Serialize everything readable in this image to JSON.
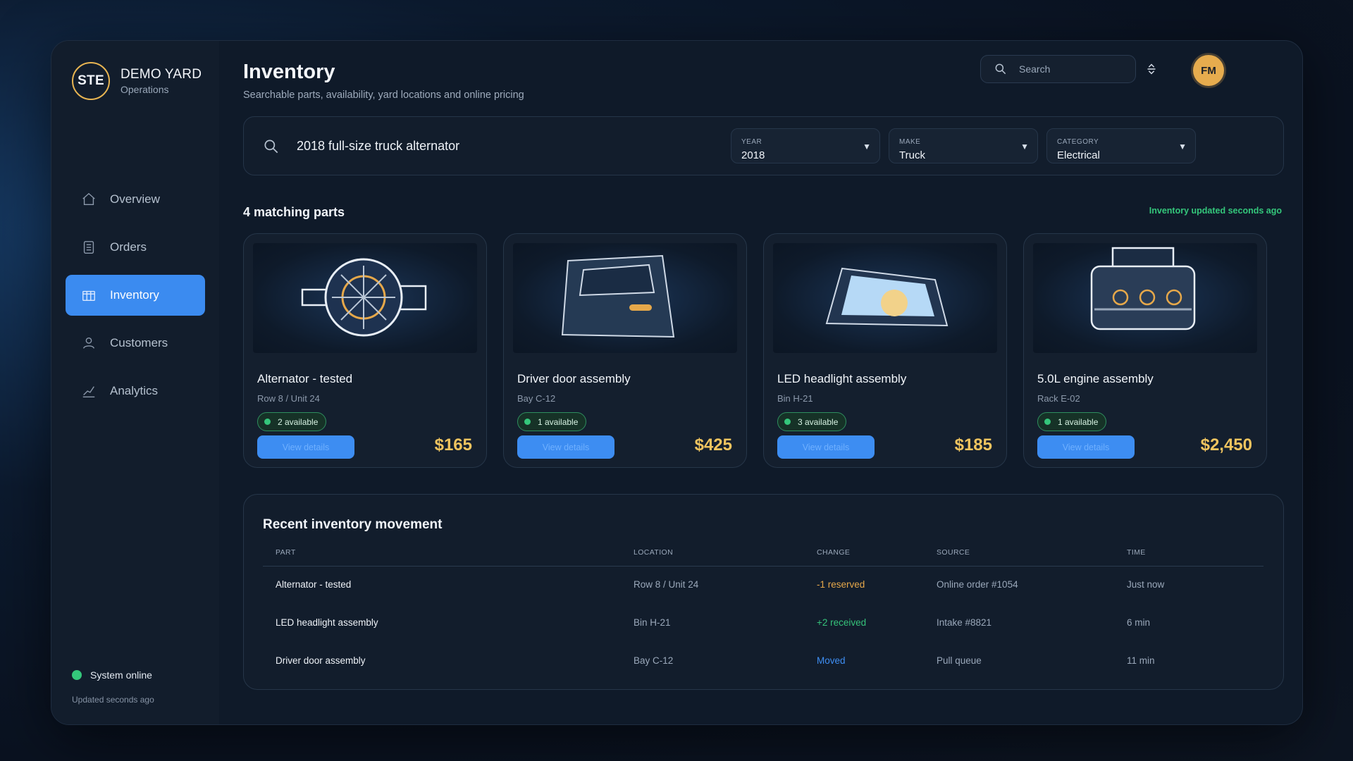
{
  "brand": {
    "logo": "STE",
    "name": "DEMO YARD",
    "sub": "Operations"
  },
  "nav": [
    {
      "label": "Overview",
      "icon": "home-icon",
      "active": false
    },
    {
      "label": "Orders",
      "icon": "document-icon",
      "active": false
    },
    {
      "label": "Inventory",
      "icon": "box-icon",
      "active": true
    },
    {
      "label": "Customers",
      "icon": "user-icon",
      "active": false
    },
    {
      "label": "Analytics",
      "icon": "chart-icon",
      "active": false
    }
  ],
  "system": {
    "status": "System online",
    "updated": "Updated seconds ago",
    "status_color": "#34c77b"
  },
  "header": {
    "title": "Inventory",
    "subtitle": "Searchable parts, availability, yard locations and online pricing",
    "search_placeholder": "Search",
    "avatar": "FM"
  },
  "search": {
    "query": "2018 full-size truck alternator",
    "filters": [
      {
        "label": "YEAR",
        "value": "2018"
      },
      {
        "label": "MAKE",
        "value": "Truck"
      },
      {
        "label": "CATEGORY",
        "value": "Electrical"
      }
    ]
  },
  "results": {
    "count_label": "4 matching parts",
    "updated_label": "Inventory updated seconds ago"
  },
  "parts": [
    {
      "title": "Alternator - tested",
      "location": "Row 8 / Unit 24",
      "availability": "2 available",
      "button": "View details",
      "price": "$165",
      "image": "alternator"
    },
    {
      "title": "Driver door assembly",
      "location": "Bay C-12",
      "availability": "1 available",
      "button": "View details",
      "price": "$425",
      "image": "door"
    },
    {
      "title": "LED headlight assembly",
      "location": "Bin H-21",
      "availability": "3 available",
      "button": "View details",
      "price": "$185",
      "image": "headlight"
    },
    {
      "title": "5.0L engine assembly",
      "location": "Rack E-02",
      "availability": "1 available",
      "button": "View details",
      "price": "$2,450",
      "image": "engine"
    }
  ],
  "movement": {
    "title": "Recent inventory movement",
    "columns": [
      "PART",
      "LOCATION",
      "CHANGE",
      "SOURCE",
      "TIME"
    ],
    "rows": [
      {
        "part": "Alternator - tested",
        "location": "Row 8 / Unit 24",
        "change": "-1 reserved",
        "change_type": "reserved",
        "source": "Online order #1054",
        "time": "Just now"
      },
      {
        "part": "LED headlight assembly",
        "location": "Bin H-21",
        "change": "+2 received",
        "change_type": "received",
        "source": "Intake #8821",
        "time": "6 min"
      },
      {
        "part": "Driver door assembly",
        "location": "Bay C-12",
        "change": "Moved",
        "change_type": "moved",
        "source": "Pull queue",
        "time": "11 min"
      }
    ]
  },
  "colors": {
    "accent": "#3b8bf0",
    "price": "#f0c45f",
    "success": "#34c77b",
    "warning": "#e6a84a"
  }
}
